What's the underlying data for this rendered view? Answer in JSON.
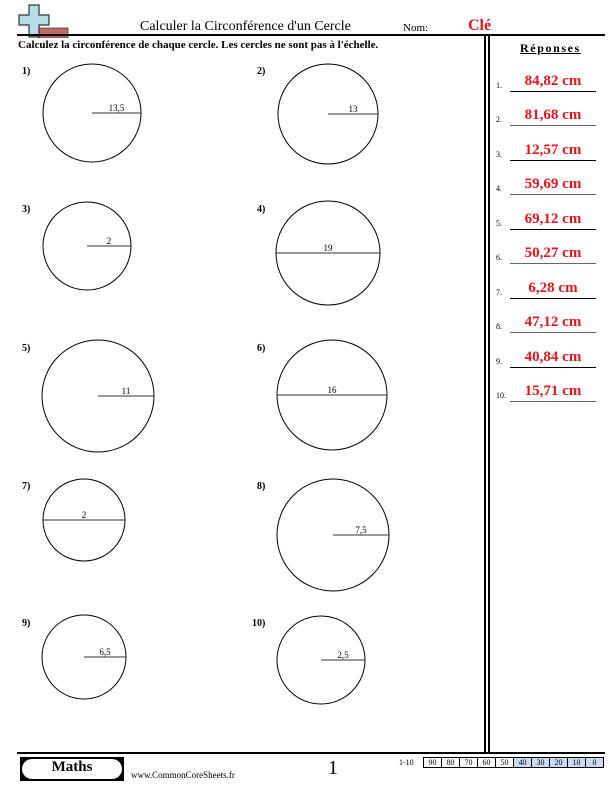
{
  "header": {
    "title": "Calculer la Circonférence d'un Cercle",
    "nom_label": "Nom:",
    "nom_value": "Clé",
    "logo_icon": "math-plus-logo-icon"
  },
  "instructions": "Calculez la circonférence de chaque cercle. Les cercles ne sont pas à l'échelle.",
  "problems": [
    {
      "num": "1)",
      "measure": "radius",
      "label": "13,5"
    },
    {
      "num": "2)",
      "measure": "radius",
      "label": "13"
    },
    {
      "num": "3)",
      "measure": "radius",
      "label": "2"
    },
    {
      "num": "4)",
      "measure": "diameter",
      "label": "19"
    },
    {
      "num": "5)",
      "measure": "radius",
      "label": "11"
    },
    {
      "num": "6)",
      "measure": "diameter",
      "label": "16"
    },
    {
      "num": "7)",
      "measure": "diameter",
      "label": "2"
    },
    {
      "num": "8)",
      "measure": "radius",
      "label": "7,5"
    },
    {
      "num": "9)",
      "measure": "radius",
      "label": "6,5"
    },
    {
      "num": "10)",
      "measure": "radius",
      "label": "2,5"
    }
  ],
  "answers": {
    "heading": "Réponses",
    "items": [
      {
        "num": "1.",
        "value": "84,82 cm"
      },
      {
        "num": "2.",
        "value": "81,68 cm"
      },
      {
        "num": "3.",
        "value": "12,57 cm"
      },
      {
        "num": "4.",
        "value": "59,69 cm"
      },
      {
        "num": "5.",
        "value": "69,12 cm"
      },
      {
        "num": "6.",
        "value": "50,27 cm"
      },
      {
        "num": "7.",
        "value": "6,28 cm"
      },
      {
        "num": "8.",
        "value": "47,12 cm"
      },
      {
        "num": "9.",
        "value": "40,84 cm"
      },
      {
        "num": "10.",
        "value": "15,71 cm"
      }
    ]
  },
  "footer": {
    "badge": "Maths",
    "site": "www.CommonCoreSheets.fr",
    "page": "1",
    "score_label": "1-10",
    "scores": [
      "90",
      "80",
      "70",
      "60",
      "50",
      "40",
      "30",
      "20",
      "10",
      "0"
    ],
    "highlighted_scores": [
      "40",
      "30",
      "20",
      "10",
      "0"
    ]
  },
  "colors": {
    "answer_red": "#e8141c",
    "score_blue": "#c9daf5"
  }
}
